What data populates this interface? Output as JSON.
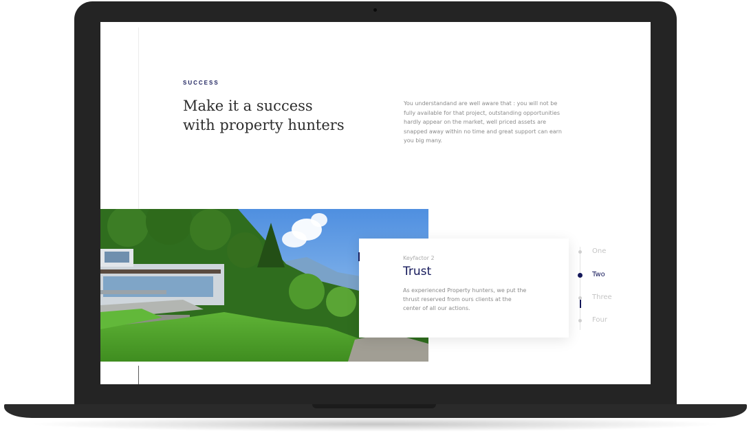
{
  "hero": {
    "eyebrow": "SUCCESS",
    "headline_line1": "Make it a success",
    "headline_line2": "with property hunters",
    "intro": "You understandand are well aware that : you will not be fully available for that project, outstanding opportunities hardly appear on the market, well priced assets are snapped away within no time and great support can earn you big many."
  },
  "keyfactor_card": {
    "kicker": "Keyfactor 2",
    "title": "Trust",
    "body": "As experienced Property hunters, we put the thrust reserved from ours clients at the center of all our actions."
  },
  "steps": {
    "items": [
      {
        "label": "One",
        "active": false
      },
      {
        "label": "Two",
        "active": true
      },
      {
        "label": "Three",
        "active": false
      },
      {
        "label": "Four",
        "active": false
      }
    ]
  },
  "colors": {
    "accent": "#14185a",
    "heading": "#2d2d2d",
    "body_text": "#8a8a8a",
    "laptop_frame": "#242424"
  },
  "icons": {
    "photo": "villa-landscape-photo"
  }
}
